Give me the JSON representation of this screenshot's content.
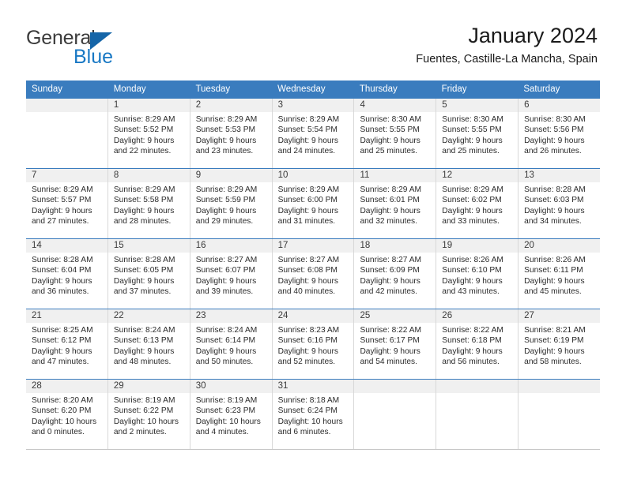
{
  "brand": {
    "name_top": "General",
    "name_bottom": "Blue",
    "triangle_color": "#1565a8",
    "blue_color": "#1878c4"
  },
  "header": {
    "title": "January 2024",
    "subtitle": "Fuentes, Castille-La Mancha, Spain"
  },
  "calendar": {
    "header_bg": "#3a7cbe",
    "weekdays": [
      "Sunday",
      "Monday",
      "Tuesday",
      "Wednesday",
      "Thursday",
      "Friday",
      "Saturday"
    ],
    "weeks": [
      [
        {
          "day": "",
          "lines": []
        },
        {
          "day": "1",
          "lines": [
            "Sunrise: 8:29 AM",
            "Sunset: 5:52 PM",
            "Daylight: 9 hours",
            "and 22 minutes."
          ]
        },
        {
          "day": "2",
          "lines": [
            "Sunrise: 8:29 AM",
            "Sunset: 5:53 PM",
            "Daylight: 9 hours",
            "and 23 minutes."
          ]
        },
        {
          "day": "3",
          "lines": [
            "Sunrise: 8:29 AM",
            "Sunset: 5:54 PM",
            "Daylight: 9 hours",
            "and 24 minutes."
          ]
        },
        {
          "day": "4",
          "lines": [
            "Sunrise: 8:30 AM",
            "Sunset: 5:55 PM",
            "Daylight: 9 hours",
            "and 25 minutes."
          ]
        },
        {
          "day": "5",
          "lines": [
            "Sunrise: 8:30 AM",
            "Sunset: 5:55 PM",
            "Daylight: 9 hours",
            "and 25 minutes."
          ]
        },
        {
          "day": "6",
          "lines": [
            "Sunrise: 8:30 AM",
            "Sunset: 5:56 PM",
            "Daylight: 9 hours",
            "and 26 minutes."
          ]
        }
      ],
      [
        {
          "day": "7",
          "lines": [
            "Sunrise: 8:29 AM",
            "Sunset: 5:57 PM",
            "Daylight: 9 hours",
            "and 27 minutes."
          ]
        },
        {
          "day": "8",
          "lines": [
            "Sunrise: 8:29 AM",
            "Sunset: 5:58 PM",
            "Daylight: 9 hours",
            "and 28 minutes."
          ]
        },
        {
          "day": "9",
          "lines": [
            "Sunrise: 8:29 AM",
            "Sunset: 5:59 PM",
            "Daylight: 9 hours",
            "and 29 minutes."
          ]
        },
        {
          "day": "10",
          "lines": [
            "Sunrise: 8:29 AM",
            "Sunset: 6:00 PM",
            "Daylight: 9 hours",
            "and 31 minutes."
          ]
        },
        {
          "day": "11",
          "lines": [
            "Sunrise: 8:29 AM",
            "Sunset: 6:01 PM",
            "Daylight: 9 hours",
            "and 32 minutes."
          ]
        },
        {
          "day": "12",
          "lines": [
            "Sunrise: 8:29 AM",
            "Sunset: 6:02 PM",
            "Daylight: 9 hours",
            "and 33 minutes."
          ]
        },
        {
          "day": "13",
          "lines": [
            "Sunrise: 8:28 AM",
            "Sunset: 6:03 PM",
            "Daylight: 9 hours",
            "and 34 minutes."
          ]
        }
      ],
      [
        {
          "day": "14",
          "lines": [
            "Sunrise: 8:28 AM",
            "Sunset: 6:04 PM",
            "Daylight: 9 hours",
            "and 36 minutes."
          ]
        },
        {
          "day": "15",
          "lines": [
            "Sunrise: 8:28 AM",
            "Sunset: 6:05 PM",
            "Daylight: 9 hours",
            "and 37 minutes."
          ]
        },
        {
          "day": "16",
          "lines": [
            "Sunrise: 8:27 AM",
            "Sunset: 6:07 PM",
            "Daylight: 9 hours",
            "and 39 minutes."
          ]
        },
        {
          "day": "17",
          "lines": [
            "Sunrise: 8:27 AM",
            "Sunset: 6:08 PM",
            "Daylight: 9 hours",
            "and 40 minutes."
          ]
        },
        {
          "day": "18",
          "lines": [
            "Sunrise: 8:27 AM",
            "Sunset: 6:09 PM",
            "Daylight: 9 hours",
            "and 42 minutes."
          ]
        },
        {
          "day": "19",
          "lines": [
            "Sunrise: 8:26 AM",
            "Sunset: 6:10 PM",
            "Daylight: 9 hours",
            "and 43 minutes."
          ]
        },
        {
          "day": "20",
          "lines": [
            "Sunrise: 8:26 AM",
            "Sunset: 6:11 PM",
            "Daylight: 9 hours",
            "and 45 minutes."
          ]
        }
      ],
      [
        {
          "day": "21",
          "lines": [
            "Sunrise: 8:25 AM",
            "Sunset: 6:12 PM",
            "Daylight: 9 hours",
            "and 47 minutes."
          ]
        },
        {
          "day": "22",
          "lines": [
            "Sunrise: 8:24 AM",
            "Sunset: 6:13 PM",
            "Daylight: 9 hours",
            "and 48 minutes."
          ]
        },
        {
          "day": "23",
          "lines": [
            "Sunrise: 8:24 AM",
            "Sunset: 6:14 PM",
            "Daylight: 9 hours",
            "and 50 minutes."
          ]
        },
        {
          "day": "24",
          "lines": [
            "Sunrise: 8:23 AM",
            "Sunset: 6:16 PM",
            "Daylight: 9 hours",
            "and 52 minutes."
          ]
        },
        {
          "day": "25",
          "lines": [
            "Sunrise: 8:22 AM",
            "Sunset: 6:17 PM",
            "Daylight: 9 hours",
            "and 54 minutes."
          ]
        },
        {
          "day": "26",
          "lines": [
            "Sunrise: 8:22 AM",
            "Sunset: 6:18 PM",
            "Daylight: 9 hours",
            "and 56 minutes."
          ]
        },
        {
          "day": "27",
          "lines": [
            "Sunrise: 8:21 AM",
            "Sunset: 6:19 PM",
            "Daylight: 9 hours",
            "and 58 minutes."
          ]
        }
      ],
      [
        {
          "day": "28",
          "lines": [
            "Sunrise: 8:20 AM",
            "Sunset: 6:20 PM",
            "Daylight: 10 hours",
            "and 0 minutes."
          ]
        },
        {
          "day": "29",
          "lines": [
            "Sunrise: 8:19 AM",
            "Sunset: 6:22 PM",
            "Daylight: 10 hours",
            "and 2 minutes."
          ]
        },
        {
          "day": "30",
          "lines": [
            "Sunrise: 8:19 AM",
            "Sunset: 6:23 PM",
            "Daylight: 10 hours",
            "and 4 minutes."
          ]
        },
        {
          "day": "31",
          "lines": [
            "Sunrise: 8:18 AM",
            "Sunset: 6:24 PM",
            "Daylight: 10 hours",
            "and 6 minutes."
          ]
        },
        {
          "day": "",
          "lines": []
        },
        {
          "day": "",
          "lines": []
        },
        {
          "day": "",
          "lines": []
        }
      ]
    ]
  }
}
